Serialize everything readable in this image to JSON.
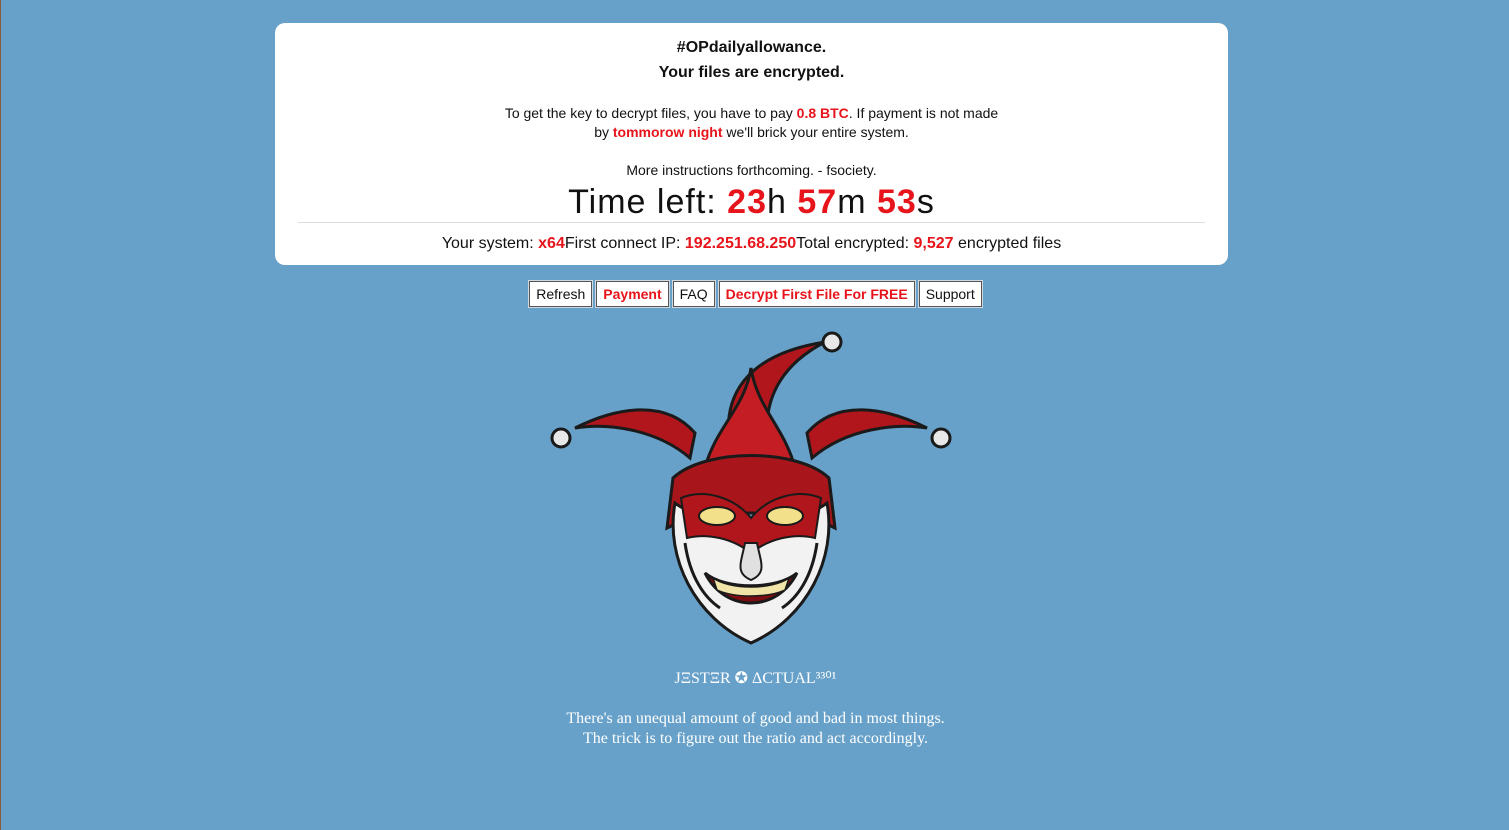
{
  "header": {
    "hashtag": "#OPdailyallowance.",
    "encrypted": "Your files are encrypted."
  },
  "instructions": {
    "part1": "To get the key to decrypt files, you have to pay ",
    "amount": "0.8 BTC",
    "part2": ". If payment is not made",
    "part3": "by ",
    "deadline": "tommorow night",
    "part4": " we'll brick your entire system."
  },
  "more": "More instructions forthcoming. - fsociety.",
  "timer": {
    "label": "Time left: ",
    "hours": "23",
    "h_unit": "h",
    "minutes": "57",
    "m_unit": "m",
    "seconds": "53",
    "s_unit": "s"
  },
  "system": {
    "system_label": "Your system: ",
    "system_value": "x64",
    "ip_label": "First connect IP: ",
    "ip_value": "192.251.68.250",
    "total_label": "Total encrypted: ",
    "total_value": "9,527",
    "total_suffix": " encrypted files"
  },
  "buttons": {
    "refresh": "Refresh",
    "payment": "Payment",
    "faq": "FAQ",
    "decrypt": "Decrypt First File For FREE",
    "support": "Support"
  },
  "signature": "JΞSTΞR ✪ ΔCTUAL³³⁰¹",
  "quote": {
    "line1": "There's an unequal amount of good and bad in most things.",
    "line2": "The trick is to figure out the ratio and act accordingly."
  },
  "colors": {
    "background": "#67a1c9",
    "accent_red": "#e8141b",
    "card": "#ffffff"
  },
  "icons": {
    "jester": "jester-mask-image"
  }
}
